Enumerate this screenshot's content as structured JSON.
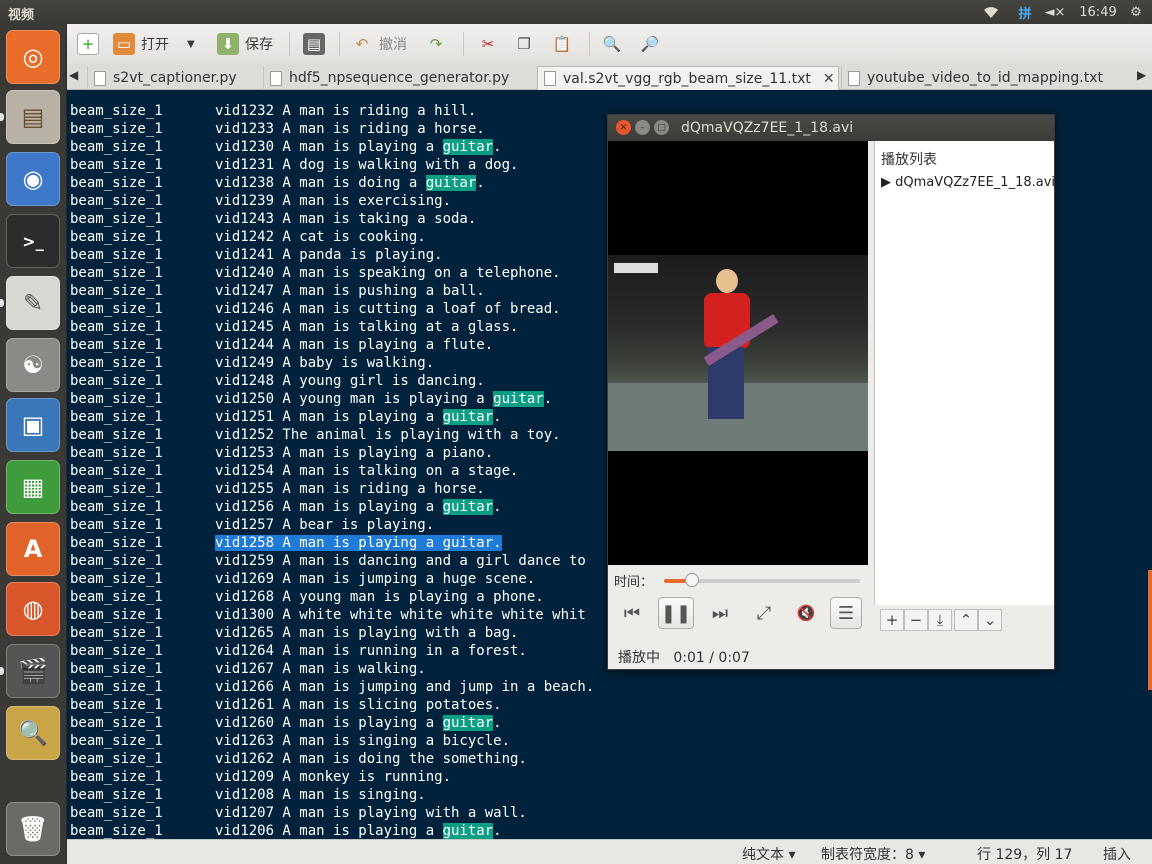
{
  "topbar": {
    "title": "视频",
    "ime": "拼",
    "time": "16:49"
  },
  "toolbar": {
    "open_label": "打开",
    "save_label": "保存",
    "undo_label": "撤消"
  },
  "tabs": [
    {
      "label": "s2vt_captioner.py"
    },
    {
      "label": "hdf5_npsequence_generator.py"
    },
    {
      "label": "val.s2vt_vgg_rgb_beam_size_11.txt"
    },
    {
      "label": "youtube_video_to_id_mapping.txt"
    }
  ],
  "lines": [
    {
      "c1": "beam_size_1",
      "c2": "vid1232 A man is riding a hill.",
      "hl": null
    },
    {
      "c1": "beam_size_1",
      "c2": "vid1233 A man is riding a horse.",
      "hl": null
    },
    {
      "c1": "beam_size_1",
      "c2": "vid1230 A man is playing a ",
      "hl": "guitar",
      "tail": "."
    },
    {
      "c1": "beam_size_1",
      "c2": "vid1231 A dog is walking with a dog.",
      "hl": null
    },
    {
      "c1": "beam_size_1",
      "c2": "vid1238 A man is doing a ",
      "hl": "guitar",
      "tail": "."
    },
    {
      "c1": "beam_size_1",
      "c2": "vid1239 A man is exercising.",
      "hl": null
    },
    {
      "c1": "beam_size_1",
      "c2": "vid1243 A man is taking a soda.",
      "hl": null
    },
    {
      "c1": "beam_size_1",
      "c2": "vid1242 A cat is cooking.",
      "hl": null
    },
    {
      "c1": "beam_size_1",
      "c2": "vid1241 A panda is playing.",
      "hl": null
    },
    {
      "c1": "beam_size_1",
      "c2": "vid1240 A man is speaking on a telephone.",
      "hl": null
    },
    {
      "c1": "beam_size_1",
      "c2": "vid1247 A man is pushing a ball.",
      "hl": null
    },
    {
      "c1": "beam_size_1",
      "c2": "vid1246 A man is cutting a loaf of bread.",
      "hl": null
    },
    {
      "c1": "beam_size_1",
      "c2": "vid1245 A man is talking at a glass.",
      "hl": null
    },
    {
      "c1": "beam_size_1",
      "c2": "vid1244 A man is playing a flute.",
      "hl": null
    },
    {
      "c1": "beam_size_1",
      "c2": "vid1249 A baby is walking.",
      "hl": null
    },
    {
      "c1": "beam_size_1",
      "c2": "vid1248 A young girl is dancing.",
      "hl": null
    },
    {
      "c1": "beam_size_1",
      "c2": "vid1250 A young man is playing a ",
      "hl": "guitar",
      "tail": "."
    },
    {
      "c1": "beam_size_1",
      "c2": "vid1251 A man is playing a ",
      "hl": "guitar",
      "tail": "."
    },
    {
      "c1": "beam_size_1",
      "c2": "vid1252 The animal is playing with a toy.",
      "hl": null
    },
    {
      "c1": "beam_size_1",
      "c2": "vid1253 A man is playing a piano.",
      "hl": null
    },
    {
      "c1": "beam_size_1",
      "c2": "vid1254 A man is talking on a stage.",
      "hl": null
    },
    {
      "c1": "beam_size_1",
      "c2": "vid1255 A man is riding a horse.",
      "hl": null
    },
    {
      "c1": "beam_size_1",
      "c2": "vid1256 A man is playing a ",
      "hl": "guitar",
      "tail": "."
    },
    {
      "c1": "beam_size_1",
      "c2": "vid1257 A bear is playing.",
      "hl": null
    },
    {
      "c1": "beam_size_1",
      "c2": "vid1258 A man is playing a guitar.",
      "sel": true
    },
    {
      "c1": "beam_size_1",
      "c2": "vid1259 A man is dancing and a girl dance to",
      "hl": null
    },
    {
      "c1": "beam_size_1",
      "c2": "vid1269 A man is jumping a huge scene.",
      "hl": null
    },
    {
      "c1": "beam_size_1",
      "c2": "vid1268 A young man is playing a phone.",
      "hl": null
    },
    {
      "c1": "beam_size_1",
      "c2": "vid1300 A white white white white white whit",
      "hl": null
    },
    {
      "c1": "beam_size_1",
      "c2": "vid1265 A man is playing with a bag.",
      "hl": null
    },
    {
      "c1": "beam_size_1",
      "c2": "vid1264 A man is running in a forest.",
      "hl": null
    },
    {
      "c1": "beam_size_1",
      "c2": "vid1267 A man is walking.",
      "hl": null
    },
    {
      "c1": "beam_size_1",
      "c2": "vid1266 A man is jumping and jump in a beach.",
      "hl": null
    },
    {
      "c1": "beam_size_1",
      "c2": "vid1261 A man is slicing potatoes.",
      "hl": null
    },
    {
      "c1": "beam_size_1",
      "c2": "vid1260 A man is playing a ",
      "hl": "guitar",
      "tail": "."
    },
    {
      "c1": "beam_size_1",
      "c2": "vid1263 A man is singing a bicycle.",
      "hl": null
    },
    {
      "c1": "beam_size_1",
      "c2": "vid1262 A man is doing the something.",
      "hl": null
    },
    {
      "c1": "beam_size_1",
      "c2": "vid1209 A monkey is running.",
      "hl": null
    },
    {
      "c1": "beam_size_1",
      "c2": "vid1208 A man is singing.",
      "hl": null
    },
    {
      "c1": "beam_size_1",
      "c2": "vid1207 A man is playing with a wall.",
      "hl": null
    },
    {
      "c1": "beam_size_1",
      "c2": "vid1206 A man is playing a ",
      "hl": "guitar",
      "tail": "."
    }
  ],
  "statusbar": {
    "mode": "纯文本",
    "tab_width": "制表符宽度：8",
    "position": "行 129，列 17",
    "insert": "插入"
  },
  "player": {
    "title": "dQmaVQZz7EE_1_18.avi",
    "playlist_header": "播放列表",
    "playlist_item": "dQmaVQZz7EE_1_18.avi",
    "time_label": "时间：",
    "progress": 0.143,
    "status": "播放中",
    "time": "0:01 / 0:07"
  },
  "colors": {
    "code_bg": "#00223c",
    "match_highlight": "#0a9e84",
    "selection": "#1f7bd8",
    "accent": "#e9692c"
  }
}
